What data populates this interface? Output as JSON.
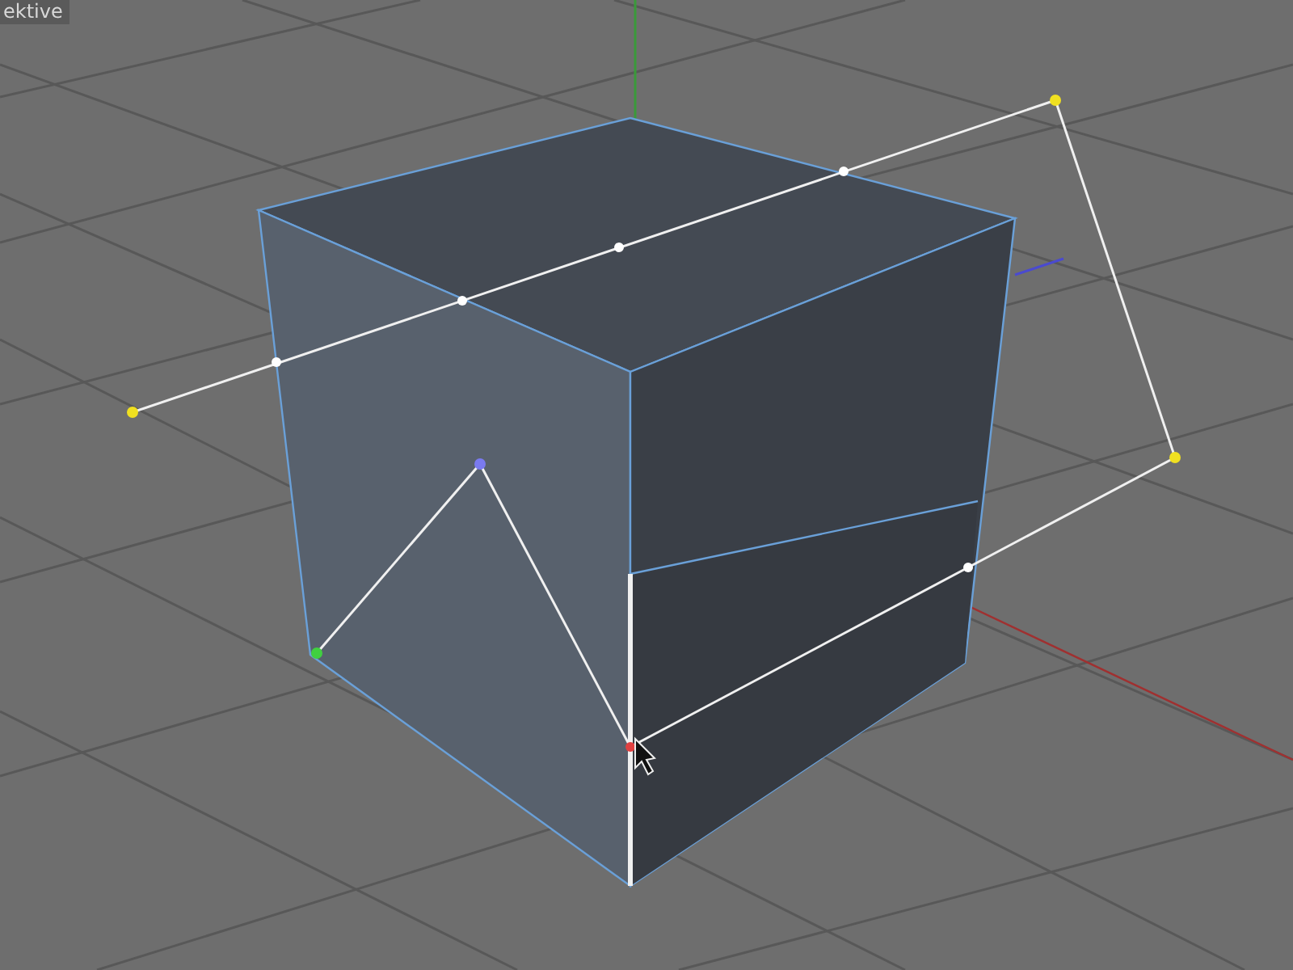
{
  "viewport": {
    "label": "ektive"
  }
}
